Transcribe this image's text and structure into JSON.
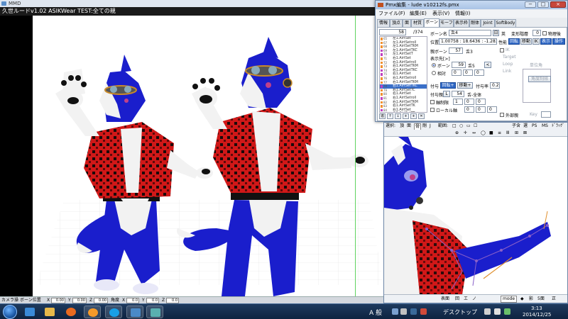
{
  "mmd": {
    "title": "MMD",
    "model_info": "久世ルードv1.02  ASIKWear TEST:全ての親",
    "bottom": {
      "camera_label": "カメラ操",
      "bone_pos_label": "ボーン位置",
      "x_label": "X",
      "x_value": "0.00",
      "y_label": "Y",
      "y_value": "0.00",
      "z_label": "Z",
      "z_value": "0.00",
      "angle_label": "角度",
      "ax_label": "X",
      "ax_value": "0.0",
      "ay_label": "Y",
      "ay_value": "0.0",
      "az_label": "Z",
      "az_value": "0.0"
    }
  },
  "pmx": {
    "title": "Pmx編集 - lude v10212fs.pmx",
    "controls": {
      "minimize": "−",
      "maximize": "□",
      "close": "×"
    },
    "menu": [
      "ファイル(F)",
      "編集(E)",
      "表示(V)",
      "情報(I)"
    ],
    "tabs": [
      "情報",
      "頂点",
      "面",
      "材質",
      "ボーン",
      "モーフ",
      "表示枠",
      "剛体",
      "Joint",
      "SoftBody"
    ],
    "selected_tab": "ボーン",
    "list_header_index": "58",
    "list_header_total": "/374",
    "bones": [
      {
        "idx": "65",
        "name": "左1.AirtSet",
        "color": "#f09030"
      },
      {
        "idx": "67",
        "name": "左1.AirtSetroll",
        "color": "#f09030"
      },
      {
        "idx": "68",
        "name": "左1.AirtSetTKM",
        "color": "#f09030"
      },
      {
        "idx": "69",
        "name": "左1.AirtSetTKC",
        "color": "#c040c0"
      },
      {
        "idx": "70",
        "name": "左1.AirtSetT",
        "color": "#c040c0"
      },
      {
        "idx": "71",
        "name": "右1.AirtSet",
        "color": "#f09030"
      },
      {
        "idx": "72",
        "name": "右1.AirtSetroll",
        "color": "#f09030"
      },
      {
        "idx": "73",
        "name": "右1.AirtSetTKM",
        "color": "#f09030"
      },
      {
        "idx": "74",
        "name": "右1.AirtSetTKC",
        "color": "#c040c0"
      },
      {
        "idx": "75",
        "name": "右1.AirtSet",
        "color": "#c040c0"
      },
      {
        "idx": "76",
        "name": "右1.AirtSetroll",
        "color": "#f09030"
      },
      {
        "idx": "77",
        "name": "右1.AirtSetTKM",
        "color": "#f09030"
      },
      {
        "idx": "78",
        "name": "右1.AirtSetTKC",
        "color": "#c040c0"
      },
      {
        "idx": "79",
        "name": "右1.AirtSetTC",
        "color": "#f09030"
      },
      {
        "idx": "80",
        "name": "右1.AirtSet",
        "color": "#f09030"
      },
      {
        "idx": "81",
        "name": "右1.AirtSetroll",
        "color": "#c040c0"
      },
      {
        "idx": "82",
        "name": "右1.AirtSetTKM",
        "color": "#f09030"
      },
      {
        "idx": "83",
        "name": "右1.AirtSetTK",
        "color": "#f09030"
      },
      {
        "idx": "84",
        "name": "右1.AirtSet",
        "color": "#c040c0"
      },
      {
        "idx": "85",
        "name": "右1.AirtSetTR",
        "color": "#f09030"
      }
    ],
    "selected_bone_index": 12,
    "list_buttons": [
      "追",
      "↑",
      "↓",
      "+",
      "+",
      "✕"
    ],
    "bone_name_label": "ボーン名",
    "bone_name_value": "舌4",
    "bone_name_btn": "日",
    "bone_name_en_btn": "英",
    "deform_label": "変形階層",
    "deform_value": "0",
    "physics_after_label": "物理後",
    "position_label": "位置",
    "position_value": "1.00758 : 18.6436 : -1.2832",
    "prop_label": "性能",
    "btn_rotate": "回転",
    "btn_move": "移動",
    "btn_ik": "IK",
    "btn_display": "表示",
    "btn_operate": "操作",
    "parent_label": "親ボーン",
    "parent_value": "57",
    "parent_name": "舌3",
    "display_label": "表示先[>]",
    "radio_bone_label": "ボーン",
    "radio_bone_value": "59",
    "radio_bone_name": "舌5",
    "radio_offset_label": "相対",
    "ik_label": "IK",
    "target_label": "Target",
    "loop_label": "Loop",
    "unit_angle_label": "単位角",
    "link_label": "Link",
    "angle_limit_btn": "角度制限",
    "grant_label": "付与",
    "grant_rotate": "回転+",
    "grant_move": "移動+",
    "grant_rate_label": "付与率",
    "grant_rate_value": "0.2",
    "grant_parent_label": "付与親",
    "grant_parent_btn": "L",
    "grant_parent_value": "54",
    "grant_parent_name": "舌-全体",
    "axis_fix_label": "軸制限",
    "local_axis_label": "ローカル軸",
    "external_parent_btn": "外部親",
    "key_label": "Key",
    "zero_values": [
      "0",
      "0",
      "0",
      "1",
      "0",
      "0",
      "0",
      "0",
      "0"
    ]
  },
  "view2": {
    "toolbar1": [
      "選択:",
      "頂",
      "面",
      "骨",
      "剛",
      "J",
      "範囲:",
      "□",
      "○",
      "▭",
      "☐",
      "子含",
      "選",
      "PS",
      "MS",
      "ﾄﾞﾗｯｸﾞ"
    ],
    "toolbar2": [
      "⊕",
      "✛",
      "↔",
      "◯",
      "■",
      "≡",
      "Ⅲ",
      "⊞",
      "⊠"
    ],
    "status": [
      "表面",
      "回",
      "エ",
      "ノ",
      "mode",
      "◆",
      "影",
      "5面",
      "正"
    ]
  },
  "taskbar": {
    "ime": "A 般",
    "desktop": "デスクトップ",
    "time": "3:13",
    "date": "2014/12/25"
  },
  "colors": {
    "fur_blue": "#1a1ecc",
    "jacket_red": "#d01818",
    "fur_white": "#f2f2f2",
    "selection_blue": "#2f67c4"
  }
}
